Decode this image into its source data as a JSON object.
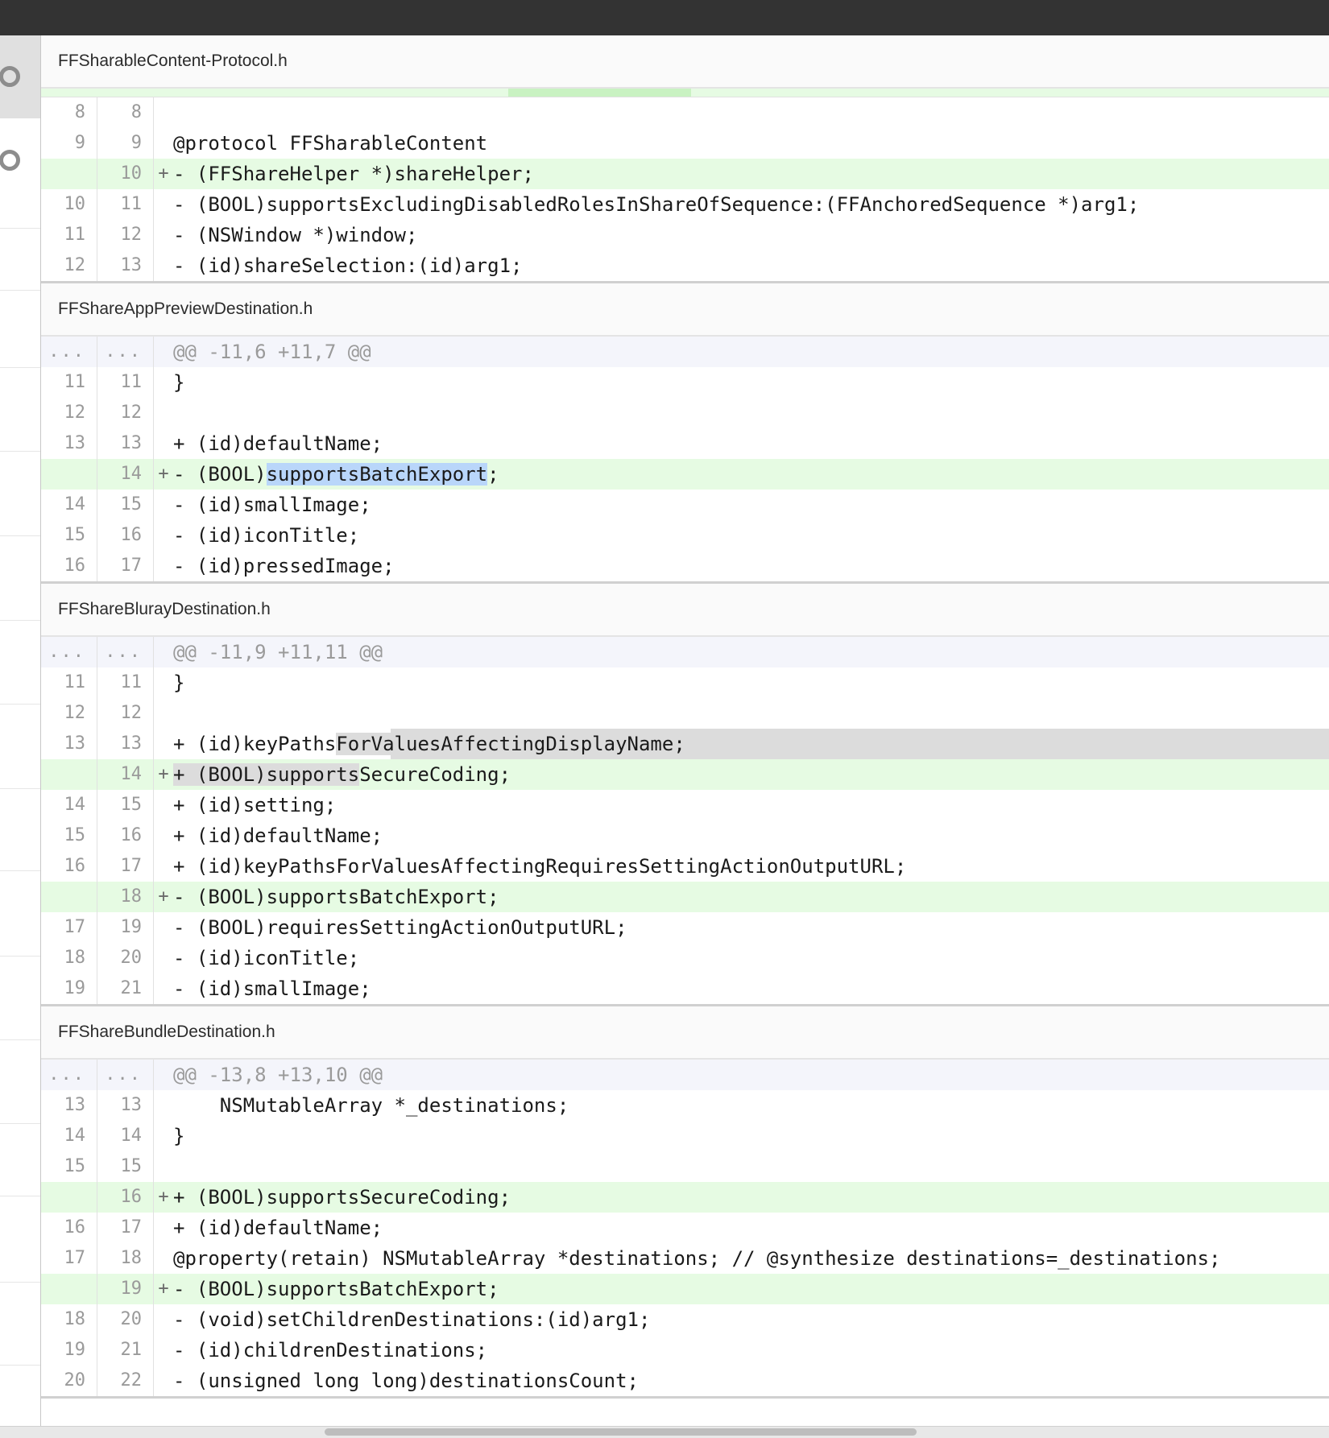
{
  "files": [
    {
      "name": "FFSharableContent-Protocol.h",
      "lines": [
        {
          "type": "context",
          "old": "8",
          "new": "8",
          "marker": "",
          "code": ""
        },
        {
          "type": "context",
          "old": "9",
          "new": "9",
          "marker": "",
          "code": "@protocol FFSharableContent"
        },
        {
          "type": "added",
          "old": "",
          "new": "10",
          "marker": "+",
          "code": "- (FFShareHelper *)shareHelper;"
        },
        {
          "type": "context",
          "old": "10",
          "new": "11",
          "marker": "",
          "code": "- (BOOL)supportsExcludingDisabledRolesInShareOfSequence:(FFAnchoredSequence *)arg1;"
        },
        {
          "type": "context",
          "old": "11",
          "new": "12",
          "marker": "",
          "code": "- (NSWindow *)window;"
        },
        {
          "type": "context",
          "old": "12",
          "new": "13",
          "marker": "",
          "code": "- (id)shareSelection:(id)arg1;"
        }
      ]
    },
    {
      "name": "FFShareAppPreviewDestination.h",
      "lines": [
        {
          "type": "hunk",
          "old": "...",
          "new": "...",
          "marker": "",
          "code": "@@ -11,6 +11,7 @@"
        },
        {
          "type": "context",
          "old": "11",
          "new": "11",
          "marker": "",
          "code": "}"
        },
        {
          "type": "context",
          "old": "12",
          "new": "12",
          "marker": "",
          "code": ""
        },
        {
          "type": "context",
          "old": "13",
          "new": "13",
          "marker": "",
          "code": "+ (id)defaultName;"
        },
        {
          "type": "added",
          "old": "",
          "new": "14",
          "marker": "+",
          "code_pre": "- (BOOL)",
          "code_hl": "supportsBatchExport",
          "code_post": ";"
        },
        {
          "type": "context",
          "old": "14",
          "new": "15",
          "marker": "",
          "code": "- (id)smallImage;"
        },
        {
          "type": "context",
          "old": "15",
          "new": "16",
          "marker": "",
          "code": "- (id)iconTitle;"
        },
        {
          "type": "context",
          "old": "16",
          "new": "17",
          "marker": "",
          "code": "- (id)pressedImage;"
        }
      ]
    },
    {
      "name": "FFShareBlurayDestination.h",
      "lines": [
        {
          "type": "hunk",
          "old": "...",
          "new": "...",
          "marker": "",
          "code": "@@ -11,9 +11,11 @@"
        },
        {
          "type": "context",
          "old": "11",
          "new": "11",
          "marker": "",
          "code": "}"
        },
        {
          "type": "context",
          "old": "12",
          "new": "12",
          "marker": "",
          "code": ""
        },
        {
          "type": "context",
          "old": "13",
          "new": "13",
          "marker": "",
          "code_pre": "+ (id)keyPaths",
          "code_hl": "ForValuesAffectingDisplayName;",
          "code_post": "",
          "gray": true
        },
        {
          "type": "added",
          "old": "",
          "new": "14",
          "marker": "+",
          "code_pre": "",
          "code_hl": "+ (BOOL)supports",
          "code_post": "SecureCoding;",
          "gray_inline": true
        },
        {
          "type": "context",
          "old": "14",
          "new": "15",
          "marker": "",
          "code": "+ (id)setting;"
        },
        {
          "type": "context",
          "old": "15",
          "new": "16",
          "marker": "",
          "code": "+ (id)defaultName;"
        },
        {
          "type": "context",
          "old": "16",
          "new": "17",
          "marker": "",
          "code": "+ (id)keyPathsForValuesAffectingRequiresSettingActionOutputURL;"
        },
        {
          "type": "added",
          "old": "",
          "new": "18",
          "marker": "+",
          "code": "- (BOOL)supportsBatchExport;"
        },
        {
          "type": "context",
          "old": "17",
          "new": "19",
          "marker": "",
          "code": "- (BOOL)requiresSettingActionOutputURL;"
        },
        {
          "type": "context",
          "old": "18",
          "new": "20",
          "marker": "",
          "code": "- (id)iconTitle;"
        },
        {
          "type": "context",
          "old": "19",
          "new": "21",
          "marker": "",
          "code": "- (id)smallImage;"
        }
      ]
    },
    {
      "name": "FFShareBundleDestination.h",
      "lines": [
        {
          "type": "hunk",
          "old": "...",
          "new": "...",
          "marker": "",
          "code": "@@ -13,8 +13,10 @@"
        },
        {
          "type": "context",
          "old": "13",
          "new": "13",
          "marker": "",
          "code": "    NSMutableArray *_destinations;"
        },
        {
          "type": "context",
          "old": "14",
          "new": "14",
          "marker": "",
          "code": "}"
        },
        {
          "type": "context",
          "old": "15",
          "new": "15",
          "marker": "",
          "code": ""
        },
        {
          "type": "added",
          "old": "",
          "new": "16",
          "marker": "+",
          "code": "+ (BOOL)supportsSecureCoding;"
        },
        {
          "type": "context",
          "old": "16",
          "new": "17",
          "marker": "",
          "code": "+ (id)defaultName;"
        },
        {
          "type": "context",
          "old": "17",
          "new": "18",
          "marker": "",
          "code": "@property(retain) NSMutableArray *destinations; // @synthesize destinations=_destinations;"
        },
        {
          "type": "added",
          "old": "",
          "new": "19",
          "marker": "+",
          "code": "- (BOOL)supportsBatchExport;"
        },
        {
          "type": "context",
          "old": "18",
          "new": "20",
          "marker": "",
          "code": "- (void)setChildrenDestinations:(id)arg1;"
        },
        {
          "type": "context",
          "old": "19",
          "new": "21",
          "marker": "",
          "code": "- (id)childrenDestinations;"
        },
        {
          "type": "context",
          "old": "20",
          "new": "22",
          "marker": "",
          "code": "- (unsigned long long)destinationsCount;"
        }
      ]
    }
  ]
}
